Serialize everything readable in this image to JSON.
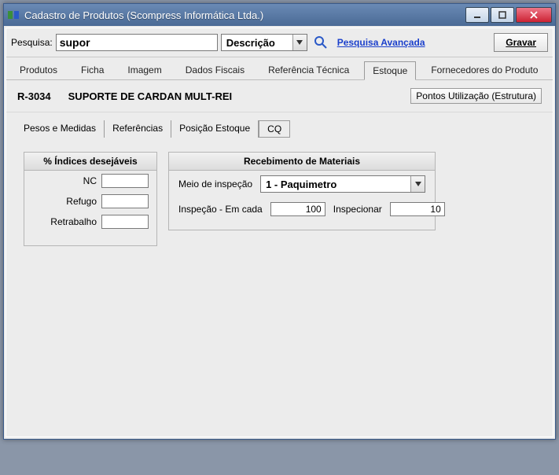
{
  "window": {
    "title": "Cadastro de Produtos (Scompress Informática Ltda.)"
  },
  "search": {
    "label": "Pesquisa:",
    "value": "supor",
    "combo": "Descrição",
    "advanced": "Pesquisa Avançada",
    "save": "Gravar"
  },
  "main_tabs": [
    "Produtos",
    "Ficha",
    "Imagem",
    "Dados Fiscais",
    "Referência Técnica",
    "Estoque",
    "Fornecedores do Produto"
  ],
  "main_tab_active": 5,
  "product": {
    "code": "R-3034",
    "desc": "SUPORTE DE CARDAN MULT-REI",
    "struct_btn": "Pontos Utilização (Estrutura)"
  },
  "sub_tabs": [
    "Pesos e Medidas",
    "Referências",
    "Posição Estoque",
    "CQ"
  ],
  "sub_tab_active": 3,
  "indices": {
    "title": "% Índices desejáveis",
    "nc_label": "NC",
    "refugo_label": "Refugo",
    "retrabalho_label": "Retrabalho",
    "nc": "",
    "refugo": "",
    "retrabalho": ""
  },
  "recebimento": {
    "title": "Recebimento de Materiais",
    "meio_label": "Meio de inspeção",
    "meio_value": "1 - Paquimetro",
    "emcada_label": "Inspeção - Em cada",
    "emcada_value": "100",
    "inspecionar_label": "Inspecionar",
    "inspecionar_value": "10"
  }
}
